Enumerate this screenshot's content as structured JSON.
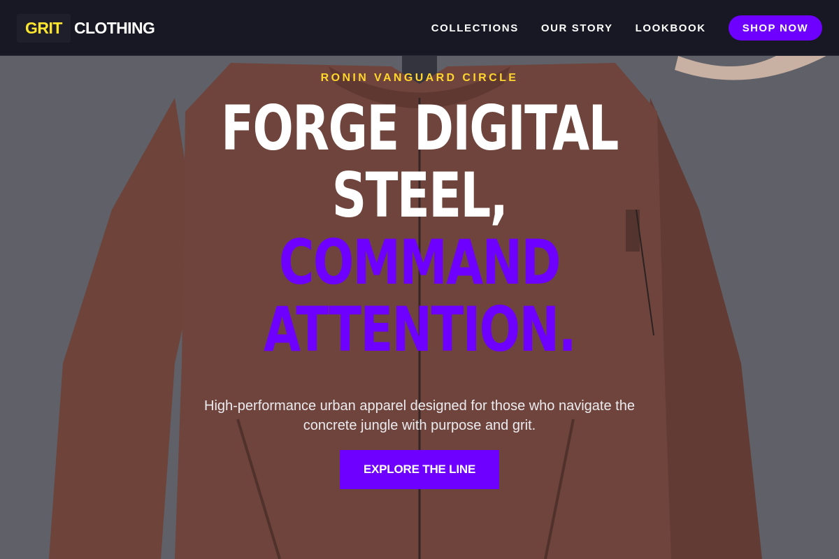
{
  "brand": {
    "logo_part1": "GRIT",
    "logo_part2": "CLOTHING"
  },
  "nav": {
    "links": [
      "COLLECTIONS",
      "OUR STORY",
      "LOOKBOOK"
    ],
    "shop_label": "SHOP NOW"
  },
  "hero": {
    "eyebrow": "RONIN VANGUARD CIRCLE",
    "headline_lines": [
      {
        "text": "FORGE DIGITAL",
        "color": "white"
      },
      {
        "text": "STEEL,",
        "color": "white"
      },
      {
        "text": "COMMAND",
        "color": "purple"
      },
      {
        "text": "ATTENTION.",
        "color": "purple"
      }
    ],
    "subtext": "High-performance urban apparel designed for those who navigate the concrete jungle with purpose and grit.",
    "cta_label": "EXPLORE THE LINE",
    "background_image": "jacket-photo"
  },
  "colors": {
    "accent": "#6d00ff",
    "logo_yellow": "#ffe62e",
    "eyebrow_yellow": "#ffd52e",
    "nav_bg": "#181824"
  }
}
